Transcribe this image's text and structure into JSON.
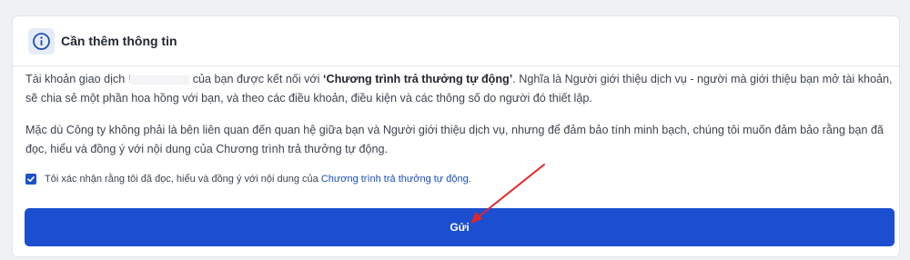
{
  "header": {
    "title": "Cần thêm thông tin",
    "icon": "info-icon"
  },
  "paragraph1": {
    "before_mask": "Tài khoản giao dịch",
    "masked_fragment": "!",
    "middle": "của bạn được kết nối với",
    "program_name_quoted": "‘Chương trình trả thưởng tự động’",
    "after": ". Nghĩa là Người giới thiệu dịch vụ - người mà giới thiệu bạn mở tài khoản, sẽ chia sẻ một phần hoa hồng với bạn, và theo các điều khoản, điều kiện và các thông số do người đó thiết lập."
  },
  "paragraph2": {
    "text": "Mặc dù Công ty không phải là bên liên quan đến quan hệ giữa bạn và Người giới thiệu dịch vụ, nhưng để đảm bảo tính minh bạch, chúng tôi muốn đảm bảo rằng bạn đã đọc, hiểu và đồng ý với nội dung của Chương trình trả thưởng tự động."
  },
  "consent": {
    "checked": true,
    "text": "Tôi xác nhận rằng tôi đã đọc, hiểu và đồng ý với nội dung của",
    "link_text": "Chương trình trả thưởng tự động",
    "suffix": "."
  },
  "submit": {
    "label": "Gửi"
  },
  "colors": {
    "accent": "#1b4fd0",
    "link": "#1b4fb8",
    "annotation_arrow": "#e0262a"
  }
}
